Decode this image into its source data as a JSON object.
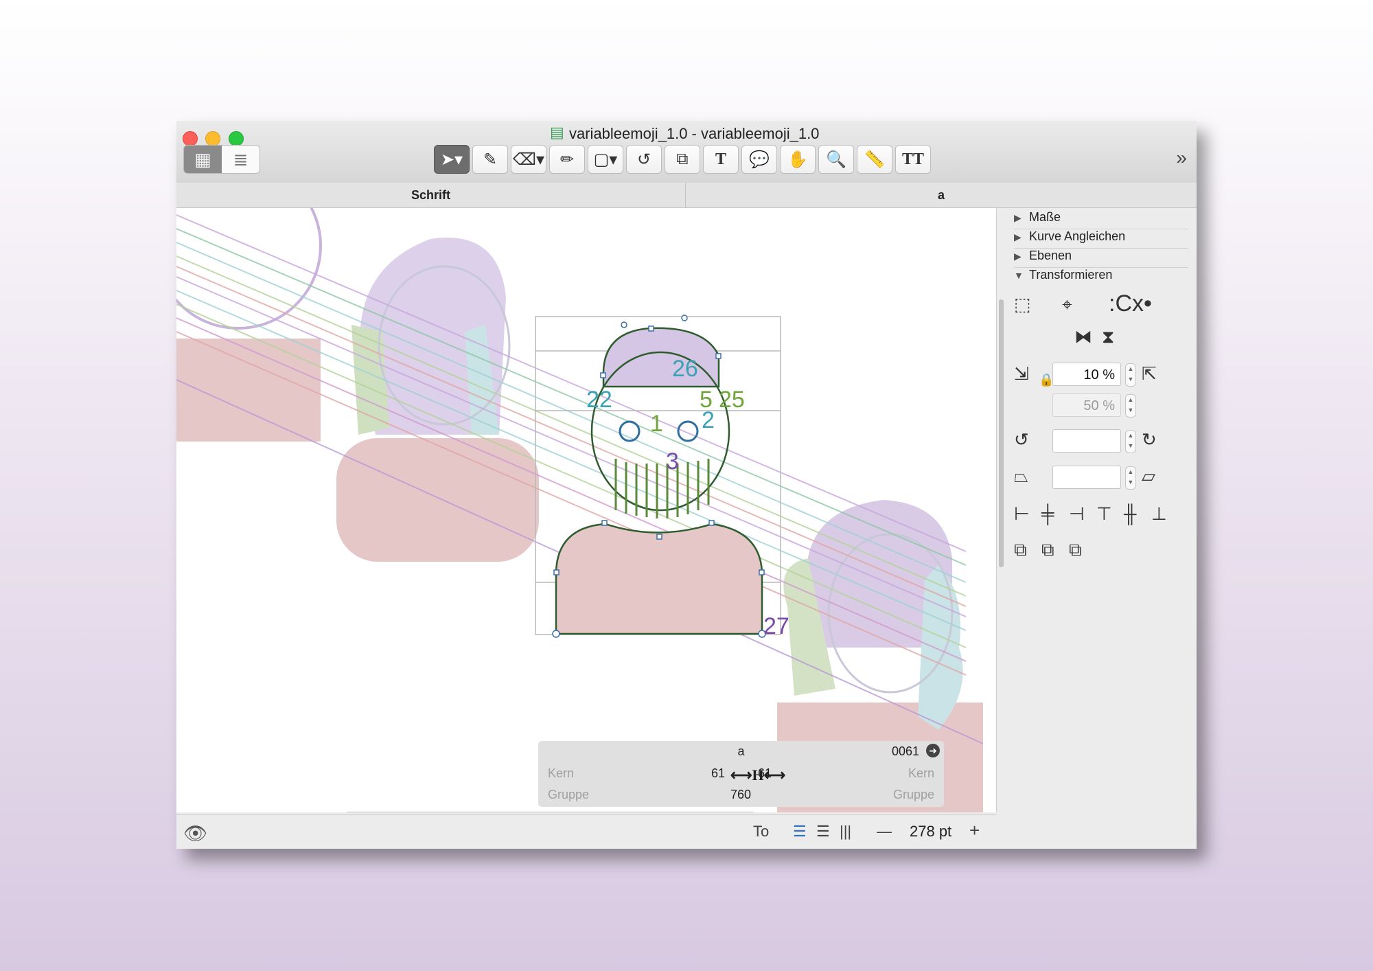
{
  "window": {
    "title": "variableemoji_1.0 - variableemoji_1.0",
    "overflow_glyph": "»"
  },
  "toolbar": {
    "view_modes": [
      "grid-view-icon",
      "list-view-icon"
    ],
    "tools": [
      {
        "name": "select-tool",
        "glyph": "➤▾",
        "active": true
      },
      {
        "name": "select-all-layers-tool",
        "glyph": "✎"
      },
      {
        "name": "eraser-tool",
        "glyph": "⌫▾"
      },
      {
        "name": "pencil-tool",
        "glyph": "✏"
      },
      {
        "name": "shape-tool",
        "glyph": "▢▾"
      },
      {
        "name": "rotate-tool",
        "glyph": "↺"
      },
      {
        "name": "scale-tool",
        "glyph": "⧉"
      },
      {
        "name": "text-tool",
        "glyph": "T"
      },
      {
        "name": "annotation-tool",
        "glyph": "💬"
      },
      {
        "name": "hand-tool",
        "glyph": "✋"
      },
      {
        "name": "zoom-tool",
        "glyph": "🔍"
      },
      {
        "name": "measurement-tool",
        "glyph": "📏"
      },
      {
        "name": "text-style-tool",
        "glyph": "TT"
      }
    ]
  },
  "tabs": {
    "font": "Schrift",
    "glyph": "a"
  },
  "canvas": {
    "point_labels": [
      "26",
      "22",
      "5",
      "25",
      "1",
      "2",
      "3",
      "27"
    ]
  },
  "metrics": {
    "glyph": "a",
    "unicode": "0061",
    "left_label": "Kern",
    "right_label": "Kern",
    "left_value": "61",
    "right_value": "61",
    "group_left": "Gruppe",
    "group_right": "Gruppe",
    "width": "760"
  },
  "status": {
    "to_label": "To",
    "zoom": "278 pt",
    "minus": "—",
    "plus": "+"
  },
  "sidebar": {
    "sections": [
      {
        "label": "Maße",
        "open": false
      },
      {
        "label": "Kurve Angleichen",
        "open": false
      },
      {
        "label": "Ebenen",
        "open": false
      },
      {
        "label": "Transformieren",
        "open": true
      }
    ],
    "transform": {
      "scale_x": "10 %",
      "scale_y": "50 %",
      "rotate_value": "",
      "slant_value": ""
    }
  }
}
